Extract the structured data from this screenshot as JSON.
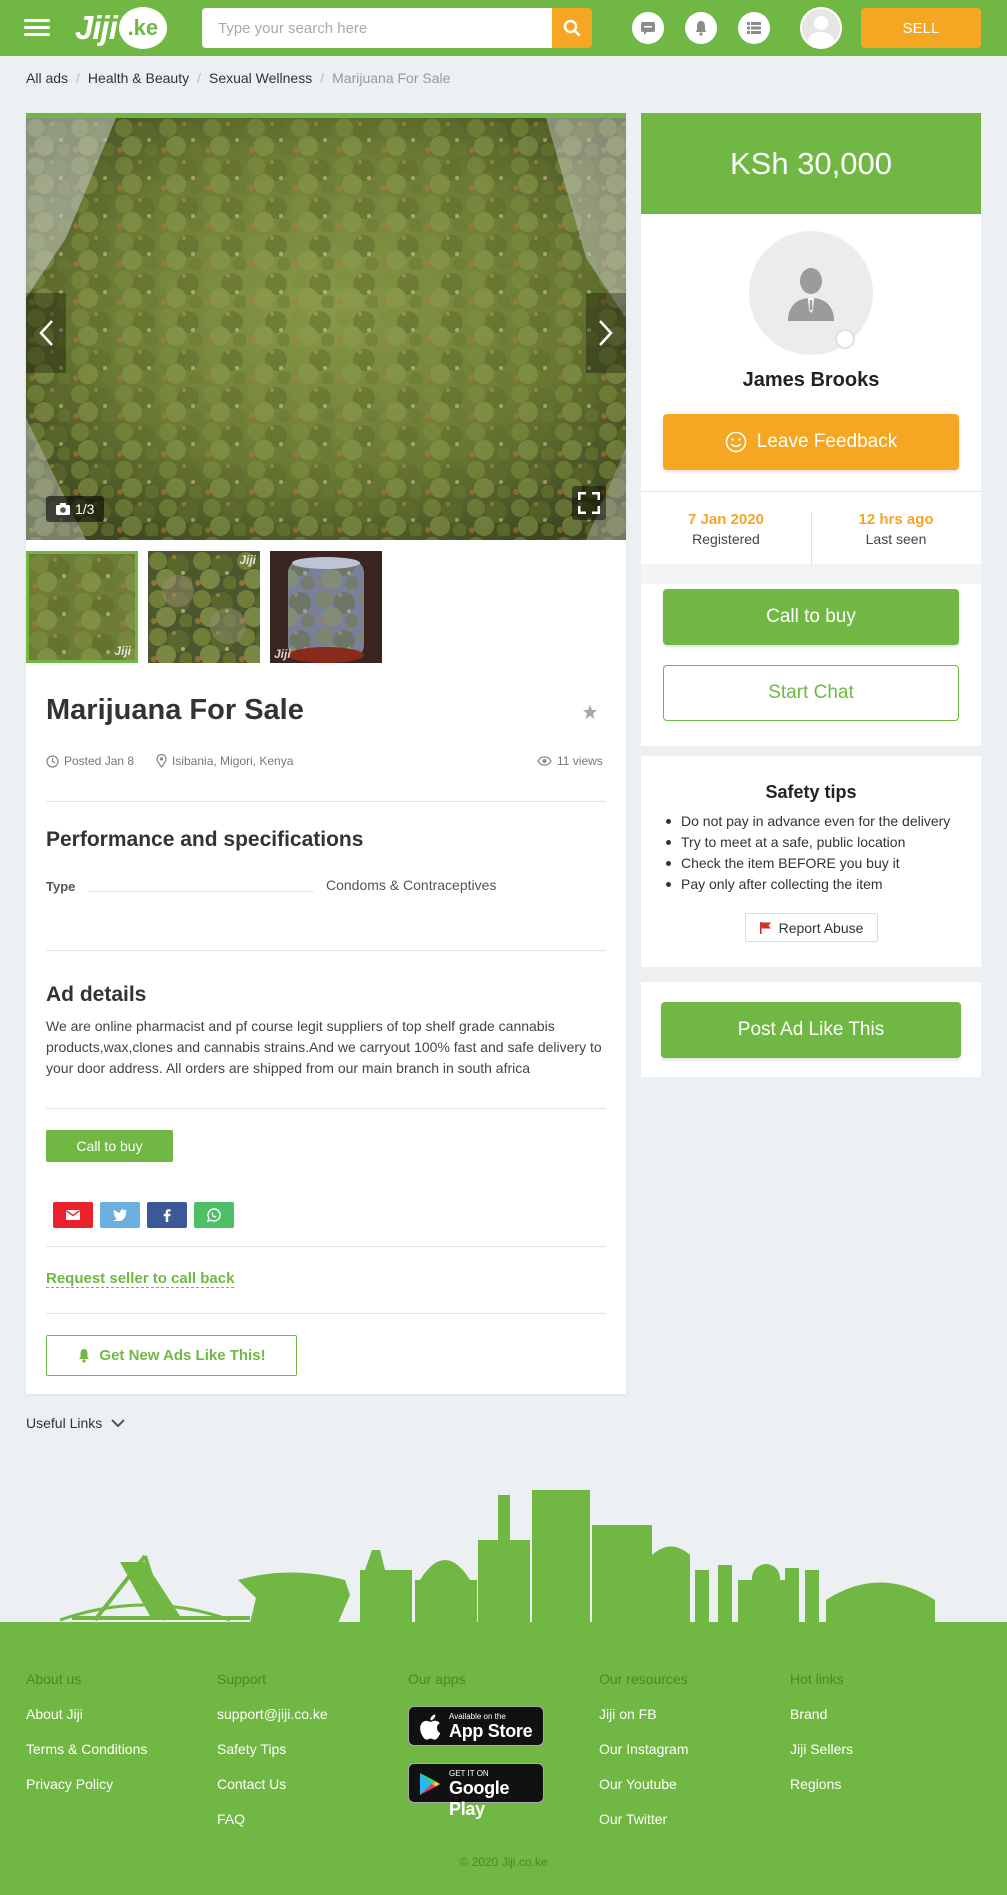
{
  "header": {
    "logo_text": "Jiji",
    "logo_suffix": ".ke",
    "search_placeholder": "Type your search here",
    "sell_label": "SELL"
  },
  "breadcrumb": {
    "items": [
      "All ads",
      "Health & Beauty",
      "Sexual Wellness"
    ],
    "current": "Marijuana For Sale"
  },
  "gallery": {
    "counter": "1/3",
    "watermark": "Jiji",
    "thumb_count": 3
  },
  "listing": {
    "title": "Marijuana For Sale",
    "posted": "Posted Jan 8",
    "location": "Isibania, Migori, Kenya",
    "views": "11 views",
    "specs_heading": "Performance and specifications",
    "spec_type_label": "Type",
    "spec_type_value": "Condoms & Contraceptives",
    "details_heading": "Ad details",
    "description": "We are online pharmacist and pf course legit suppliers of top shelf grade cannabis products,wax,clones and cannabis strains.And we carryout 100% fast and safe delivery to your door address. All orders are shipped from our main branch in south africa",
    "call_label": "Call to buy",
    "callback_label": "Request seller to call back",
    "get_ads_label": "Get New Ads Like This!"
  },
  "seller": {
    "price": "KSh 30,000",
    "name": "James Brooks",
    "feedback_label": "Leave Feedback",
    "registered_value": "7 Jan 2020",
    "registered_label": "Registered",
    "last_seen_value": "12 hrs ago",
    "last_seen_label": "Last seen",
    "call_label": "Call to buy",
    "chat_label": "Start Chat"
  },
  "safety": {
    "title": "Safety tips",
    "tips": [
      "Do not pay in advance even for the delivery",
      "Try to meet at a safe, public location",
      "Check the item BEFORE you buy it",
      "Pay only after collecting the item"
    ],
    "report_label": "Report Abuse"
  },
  "post_ad_label": "Post Ad Like This",
  "useful_links_label": "Useful Links",
  "footer": {
    "columns": [
      {
        "heading": "About us",
        "links": [
          "About Jiji",
          "Terms & Conditions",
          "Privacy Policy"
        ]
      },
      {
        "heading": "Support",
        "links": [
          "support@jiji.co.ke",
          "Safety Tips",
          "Contact Us",
          "FAQ"
        ]
      },
      {
        "heading": "Our apps",
        "links": []
      },
      {
        "heading": "Our resources",
        "links": [
          "Jiji on FB",
          "Our Instagram",
          "Our Youtube",
          "Our Twitter"
        ]
      },
      {
        "heading": "Hot links",
        "links": [
          "Brand",
          "Jiji Sellers",
          "Regions"
        ]
      }
    ],
    "app_store": {
      "small": "Available on the",
      "big": "App Store"
    },
    "google_play": {
      "small": "GET IT ON",
      "big": "Google Play"
    },
    "copyright": "© 2020 Jiji.co.ke"
  },
  "colors": {
    "brand_green": "#70b843",
    "accent_orange": "#f5a623",
    "background": "#ecf0f2"
  },
  "icons": [
    "menu-icon",
    "search-icon",
    "chat-icon",
    "bell-icon",
    "list-icon",
    "user-icon",
    "camera-icon",
    "fullscreen-icon",
    "star-icon",
    "clock-icon",
    "location-icon",
    "eye-icon",
    "smile-icon",
    "flag-icon",
    "email-icon",
    "twitter-icon",
    "facebook-icon",
    "whatsapp-icon",
    "chevron-down-icon",
    "apple-icon",
    "google-play-icon"
  ]
}
